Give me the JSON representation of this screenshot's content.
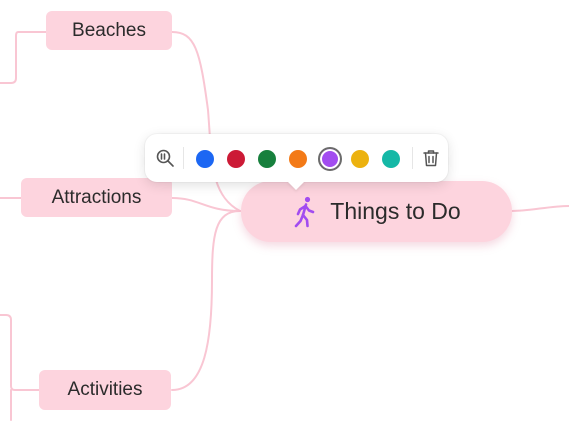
{
  "mindmap": {
    "central": {
      "label": "Things to Do",
      "icon": "walking-person-icon",
      "icon_color": "#a24cf0",
      "fill": "#fdd4de"
    },
    "branches": [
      {
        "label": "Beaches"
      },
      {
        "label": "Attractions"
      },
      {
        "label": "Activities"
      }
    ],
    "connector_color": "#f9c6d3"
  },
  "toolbar": {
    "tools": [
      "zoom-icon",
      "trash-icon"
    ],
    "colors": [
      {
        "name": "blue",
        "hex": "#1c67f3"
      },
      {
        "name": "red",
        "hex": "#cc1a36"
      },
      {
        "name": "green",
        "hex": "#17803d"
      },
      {
        "name": "orange",
        "hex": "#f37a17"
      },
      {
        "name": "purple",
        "hex": "#a24cf0",
        "selected": true
      },
      {
        "name": "yellow",
        "hex": "#ecb20f"
      },
      {
        "name": "teal",
        "hex": "#15b8a6"
      }
    ]
  }
}
